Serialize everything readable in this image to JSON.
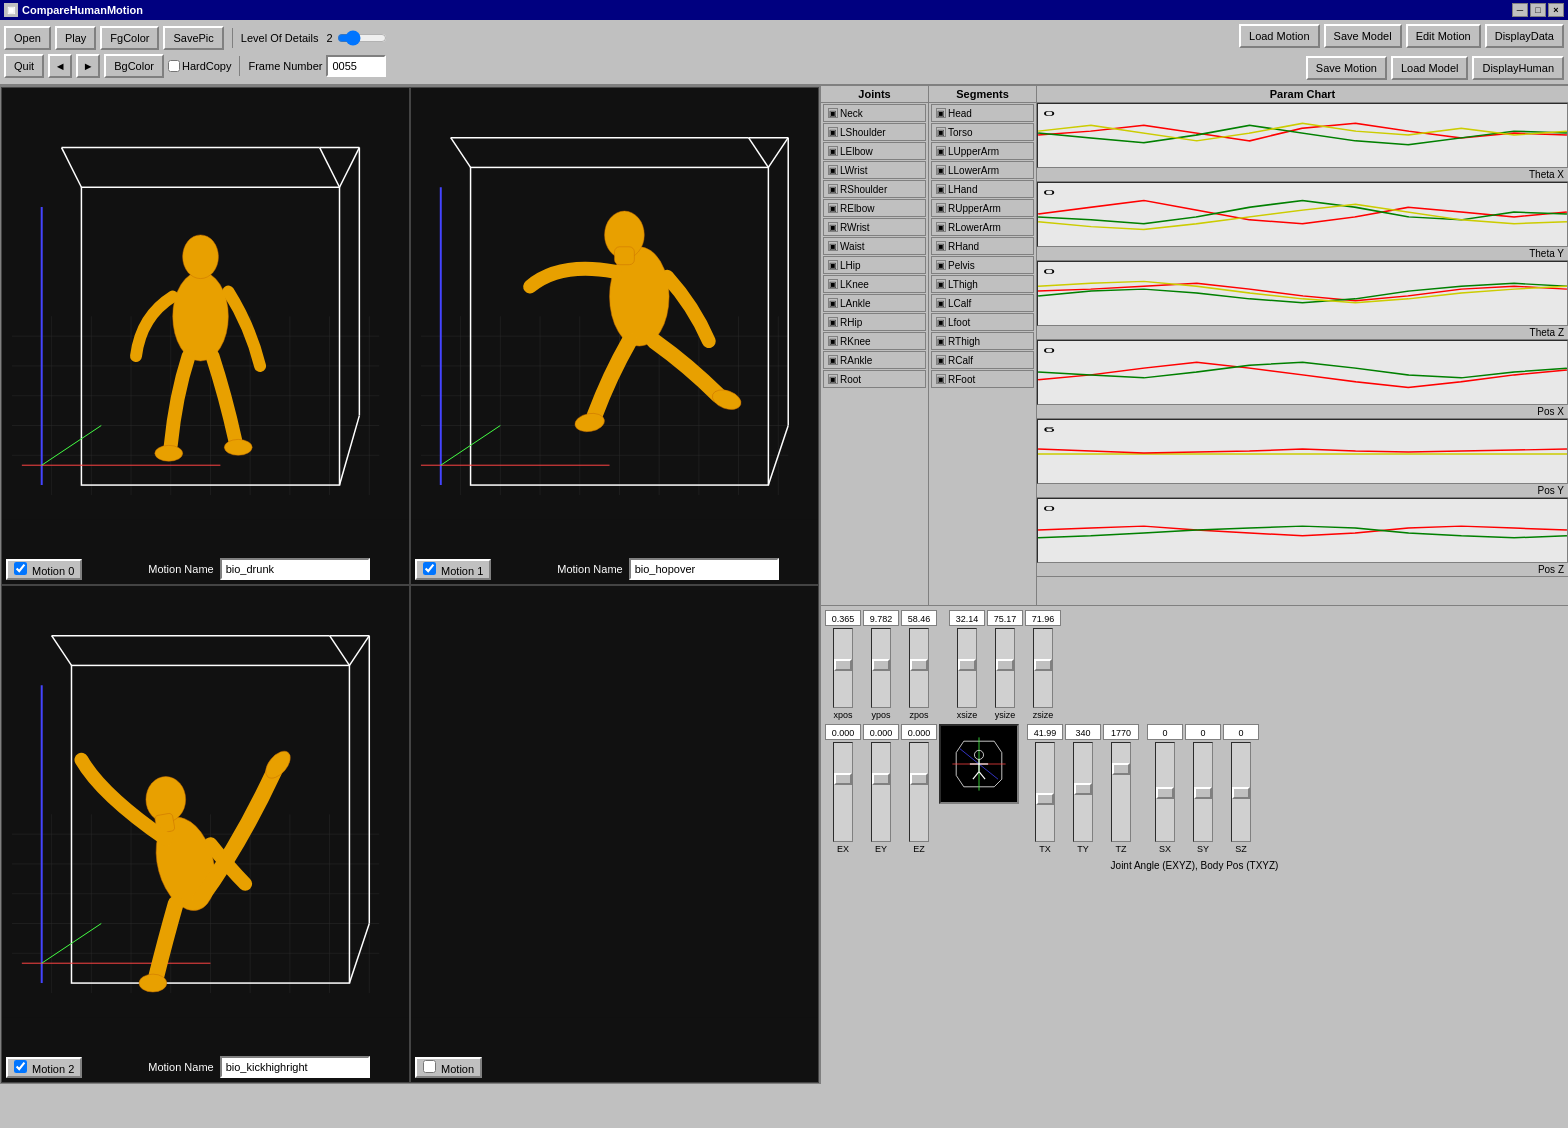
{
  "window": {
    "title": "CompareHumanMotion",
    "close_label": "×",
    "min_label": "─",
    "max_label": "□"
  },
  "toolbar": {
    "open_label": "Open",
    "play_label": "Play",
    "fg_color_label": "FgColor",
    "save_pic_label": "SavePic",
    "quit_label": "Quit",
    "prev_label": "◄",
    "next_label": "►",
    "bg_color_label": "BgColor",
    "hard_copy_label": "HardCopy",
    "level_label": "Level Of Details",
    "level_value": "2",
    "frame_label": "Frame Number",
    "frame_value": "0055"
  },
  "right_buttons": {
    "load_motion": "Load Motion",
    "save_model": "Save Model",
    "edit_motion": "Edit Motion",
    "display_data": "DisplayData",
    "save_motion": "Save Motion",
    "load_model": "Load Model",
    "display_human": "DisplayHuman"
  },
  "viewports": [
    {
      "id": 0,
      "motion_label": "Motion 0",
      "motion_name": "bio_drunk",
      "active": true
    },
    {
      "id": 1,
      "motion_label": "Motion 1",
      "motion_name": "bio_hopover",
      "active": true
    },
    {
      "id": 2,
      "motion_label": "Motion 2",
      "motion_name": "bio_kickhighright",
      "active": true
    },
    {
      "id": 3,
      "motion_label": "Motion",
      "motion_name": "",
      "active": false
    }
  ],
  "panels": {
    "joints_header": "Joints",
    "segments_header": "Segments",
    "param_chart_header": "Param Chart"
  },
  "joints": [
    "Neck",
    "LShoulder",
    "LElbow",
    "LWrist",
    "RShoulder",
    "RElbow",
    "RWrist",
    "Waist",
    "LHip",
    "LKnee",
    "LAnkle",
    "RHip",
    "RKnee",
    "RAnkle",
    "Root"
  ],
  "segments": [
    "Head",
    "Torso",
    "LUpperArm",
    "LLowerArm",
    "LHand",
    "RUpperArm",
    "RLowerArm",
    "RHand",
    "Pelvis",
    "LThigh",
    "LCalf",
    "Lfoot",
    "RThigh",
    "RCalf",
    "RFoot"
  ],
  "chart_labels": [
    "Theta X",
    "Theta Y",
    "Theta Z",
    "Pos X",
    "Pos Y",
    "Pos Z"
  ],
  "sliders_pos": {
    "xpos_val": "0.365",
    "ypos_val": "9.782",
    "zpos_val": "58.46",
    "xpos_label": "xpos",
    "ypos_label": "ypos",
    "zpos_label": "zpos",
    "xsize_val": "32.14",
    "ysize_val": "75.17",
    "zsize_val": "71.96",
    "xsize_label": "xsize",
    "ysize_label": "ysize",
    "zsize_label": "zsize"
  },
  "sliders_angle": {
    "ex_val": "0.000",
    "ey_val": "0.000",
    "ez_val": "0.000",
    "ex_label": "EX",
    "ey_label": "EY",
    "ez_label": "EZ",
    "tx_val": "41.99",
    "ty_val": "340",
    "tz_val": "1770",
    "tx_label": "TX",
    "ty_label": "TY",
    "tz_label": "TZ",
    "sx_val": "0",
    "sy_val": "0",
    "sz_val": "0",
    "sx_label": "SX",
    "sy_label": "SY",
    "sz_label": "SZ"
  },
  "footer_label": "Joint Angle (EXYZ), Body Pos (TXYZ)"
}
